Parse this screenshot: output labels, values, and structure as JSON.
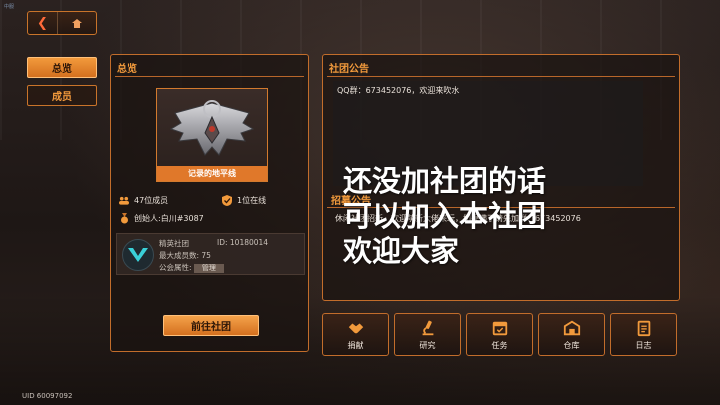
{
  "corner_tag": "中服",
  "nav": {
    "back_icon": "back-arrow-icon",
    "home_icon": "home-icon"
  },
  "side_tabs": [
    {
      "label": "总览",
      "active": true
    },
    {
      "label": "成员",
      "active": false
    }
  ],
  "overview": {
    "title": "总览",
    "club_name": "记录的地平线",
    "member_count": "47位成员",
    "online_count": "1位在线",
    "founder": "创始人:白川#3087",
    "card": {
      "type_label": "精英社团",
      "id_label": "ID: 10180014",
      "max_members": "最大成员数: 75",
      "attribute_label": "公会属性:",
      "attribute_tag": "管理"
    },
    "goto_button": "前往社团"
  },
  "notice": {
    "title": "社团公告",
    "text": "QQ群：673452076，欢迎来吹水",
    "recruit_title": "招募公告",
    "recruit_text": "休闲社团招新，欢迎萌新大佬来玩，如果满了请先加群：673452076"
  },
  "overlay": {
    "line1": "还没加社团的话",
    "line2": "可以加入本社团",
    "line3": "欢迎大家"
  },
  "actions": [
    {
      "label": "捐献",
      "icon": "handshake-icon"
    },
    {
      "label": "研究",
      "icon": "microscope-icon"
    },
    {
      "label": "任务",
      "icon": "calendar-task-icon"
    },
    {
      "label": "仓库",
      "icon": "warehouse-icon"
    },
    {
      "label": "日志",
      "icon": "log-notebook-icon"
    }
  ],
  "uid": "UID 60097092",
  "colors": {
    "accent": "#f29a3c",
    "border": "#c26d2b",
    "banner": "#e0782a"
  }
}
